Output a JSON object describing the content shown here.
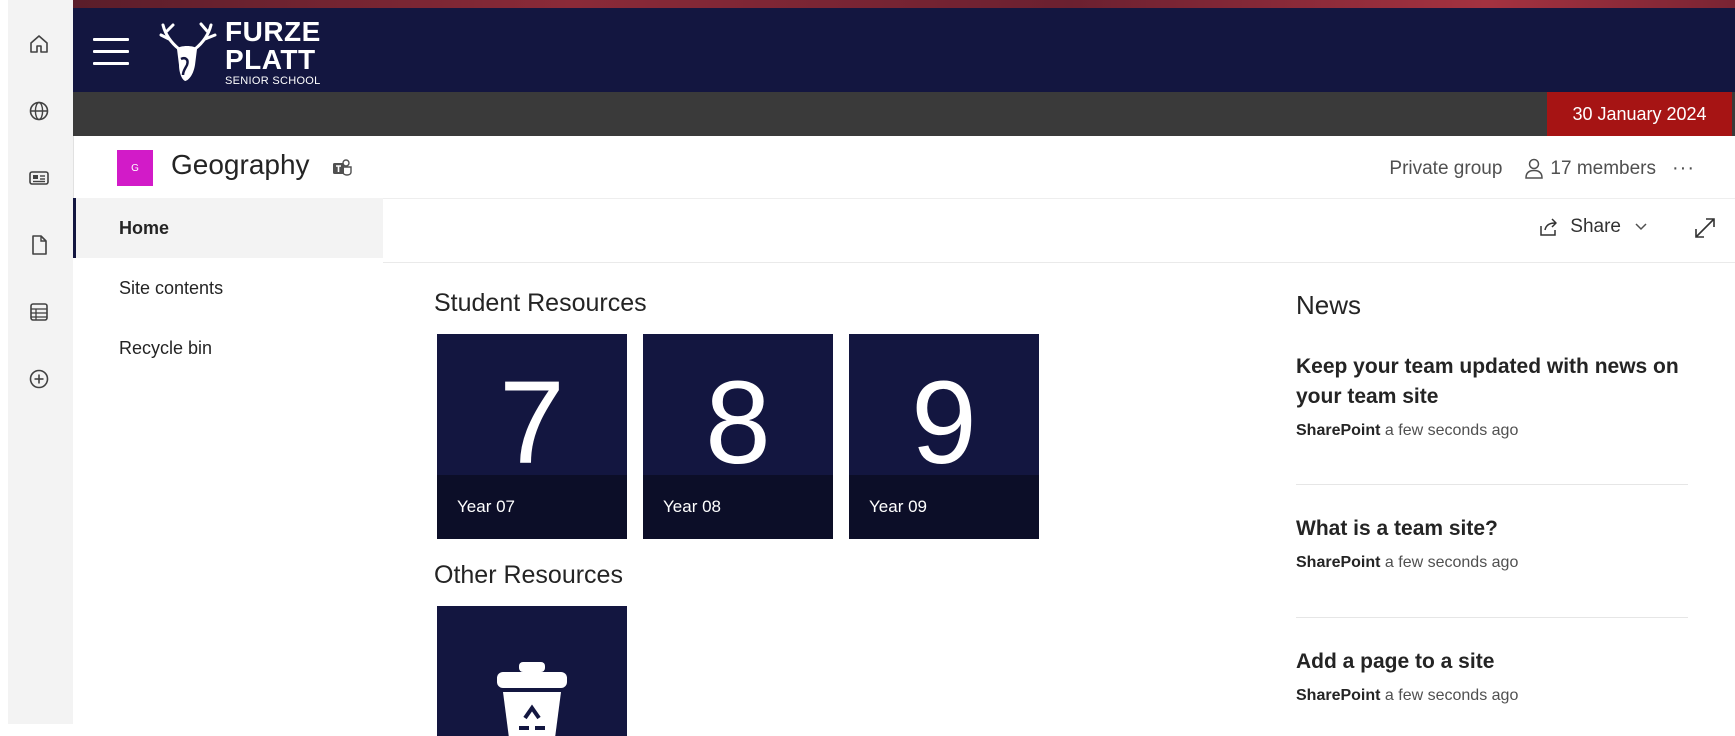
{
  "app_bar": {
    "items": [
      {
        "icon": "home-icon",
        "label": "Home"
      },
      {
        "icon": "globe-icon",
        "label": "Sites"
      },
      {
        "icon": "news-icon",
        "label": "News"
      },
      {
        "icon": "file-icon",
        "label": "Files"
      },
      {
        "icon": "list-icon",
        "label": "Lists"
      },
      {
        "icon": "add-icon",
        "label": "Create"
      }
    ]
  },
  "suite_bar": {
    "logo": {
      "line1": "FURZE",
      "line2": "PLATT",
      "line3": "SENIOR SCHOOL"
    },
    "background_color": "#131640"
  },
  "date_bar": {
    "date": "30 January 2024",
    "badge_color": "#a61414"
  },
  "site": {
    "logo_letter": "G",
    "logo_color": "#d21bc8",
    "title": "Geography",
    "privacy": "Private group",
    "members": "17 members",
    "more": "···"
  },
  "nav": {
    "items": [
      {
        "label": "Home",
        "active": true
      },
      {
        "label": "Site contents",
        "active": false
      },
      {
        "label": "Recycle bin",
        "active": false
      }
    ]
  },
  "command_bar": {
    "share_label": "Share"
  },
  "main": {
    "student_resources": {
      "title": "Student Resources",
      "tiles": [
        {
          "number": "7",
          "caption": "Year 07"
        },
        {
          "number": "8",
          "caption": "Year 08"
        },
        {
          "number": "9",
          "caption": "Year 09"
        }
      ]
    },
    "other_resources": {
      "title": "Other Resources"
    }
  },
  "news": {
    "title": "News",
    "items": [
      {
        "headline": "Keep your team updated with news on your team site",
        "author": "SharePoint",
        "time": "a few seconds ago"
      },
      {
        "headline": "What is a team site?",
        "author": "SharePoint",
        "time": "a few seconds ago"
      },
      {
        "headline": "Add a page to a site",
        "author": "SharePoint",
        "time": "a few seconds ago"
      }
    ]
  }
}
